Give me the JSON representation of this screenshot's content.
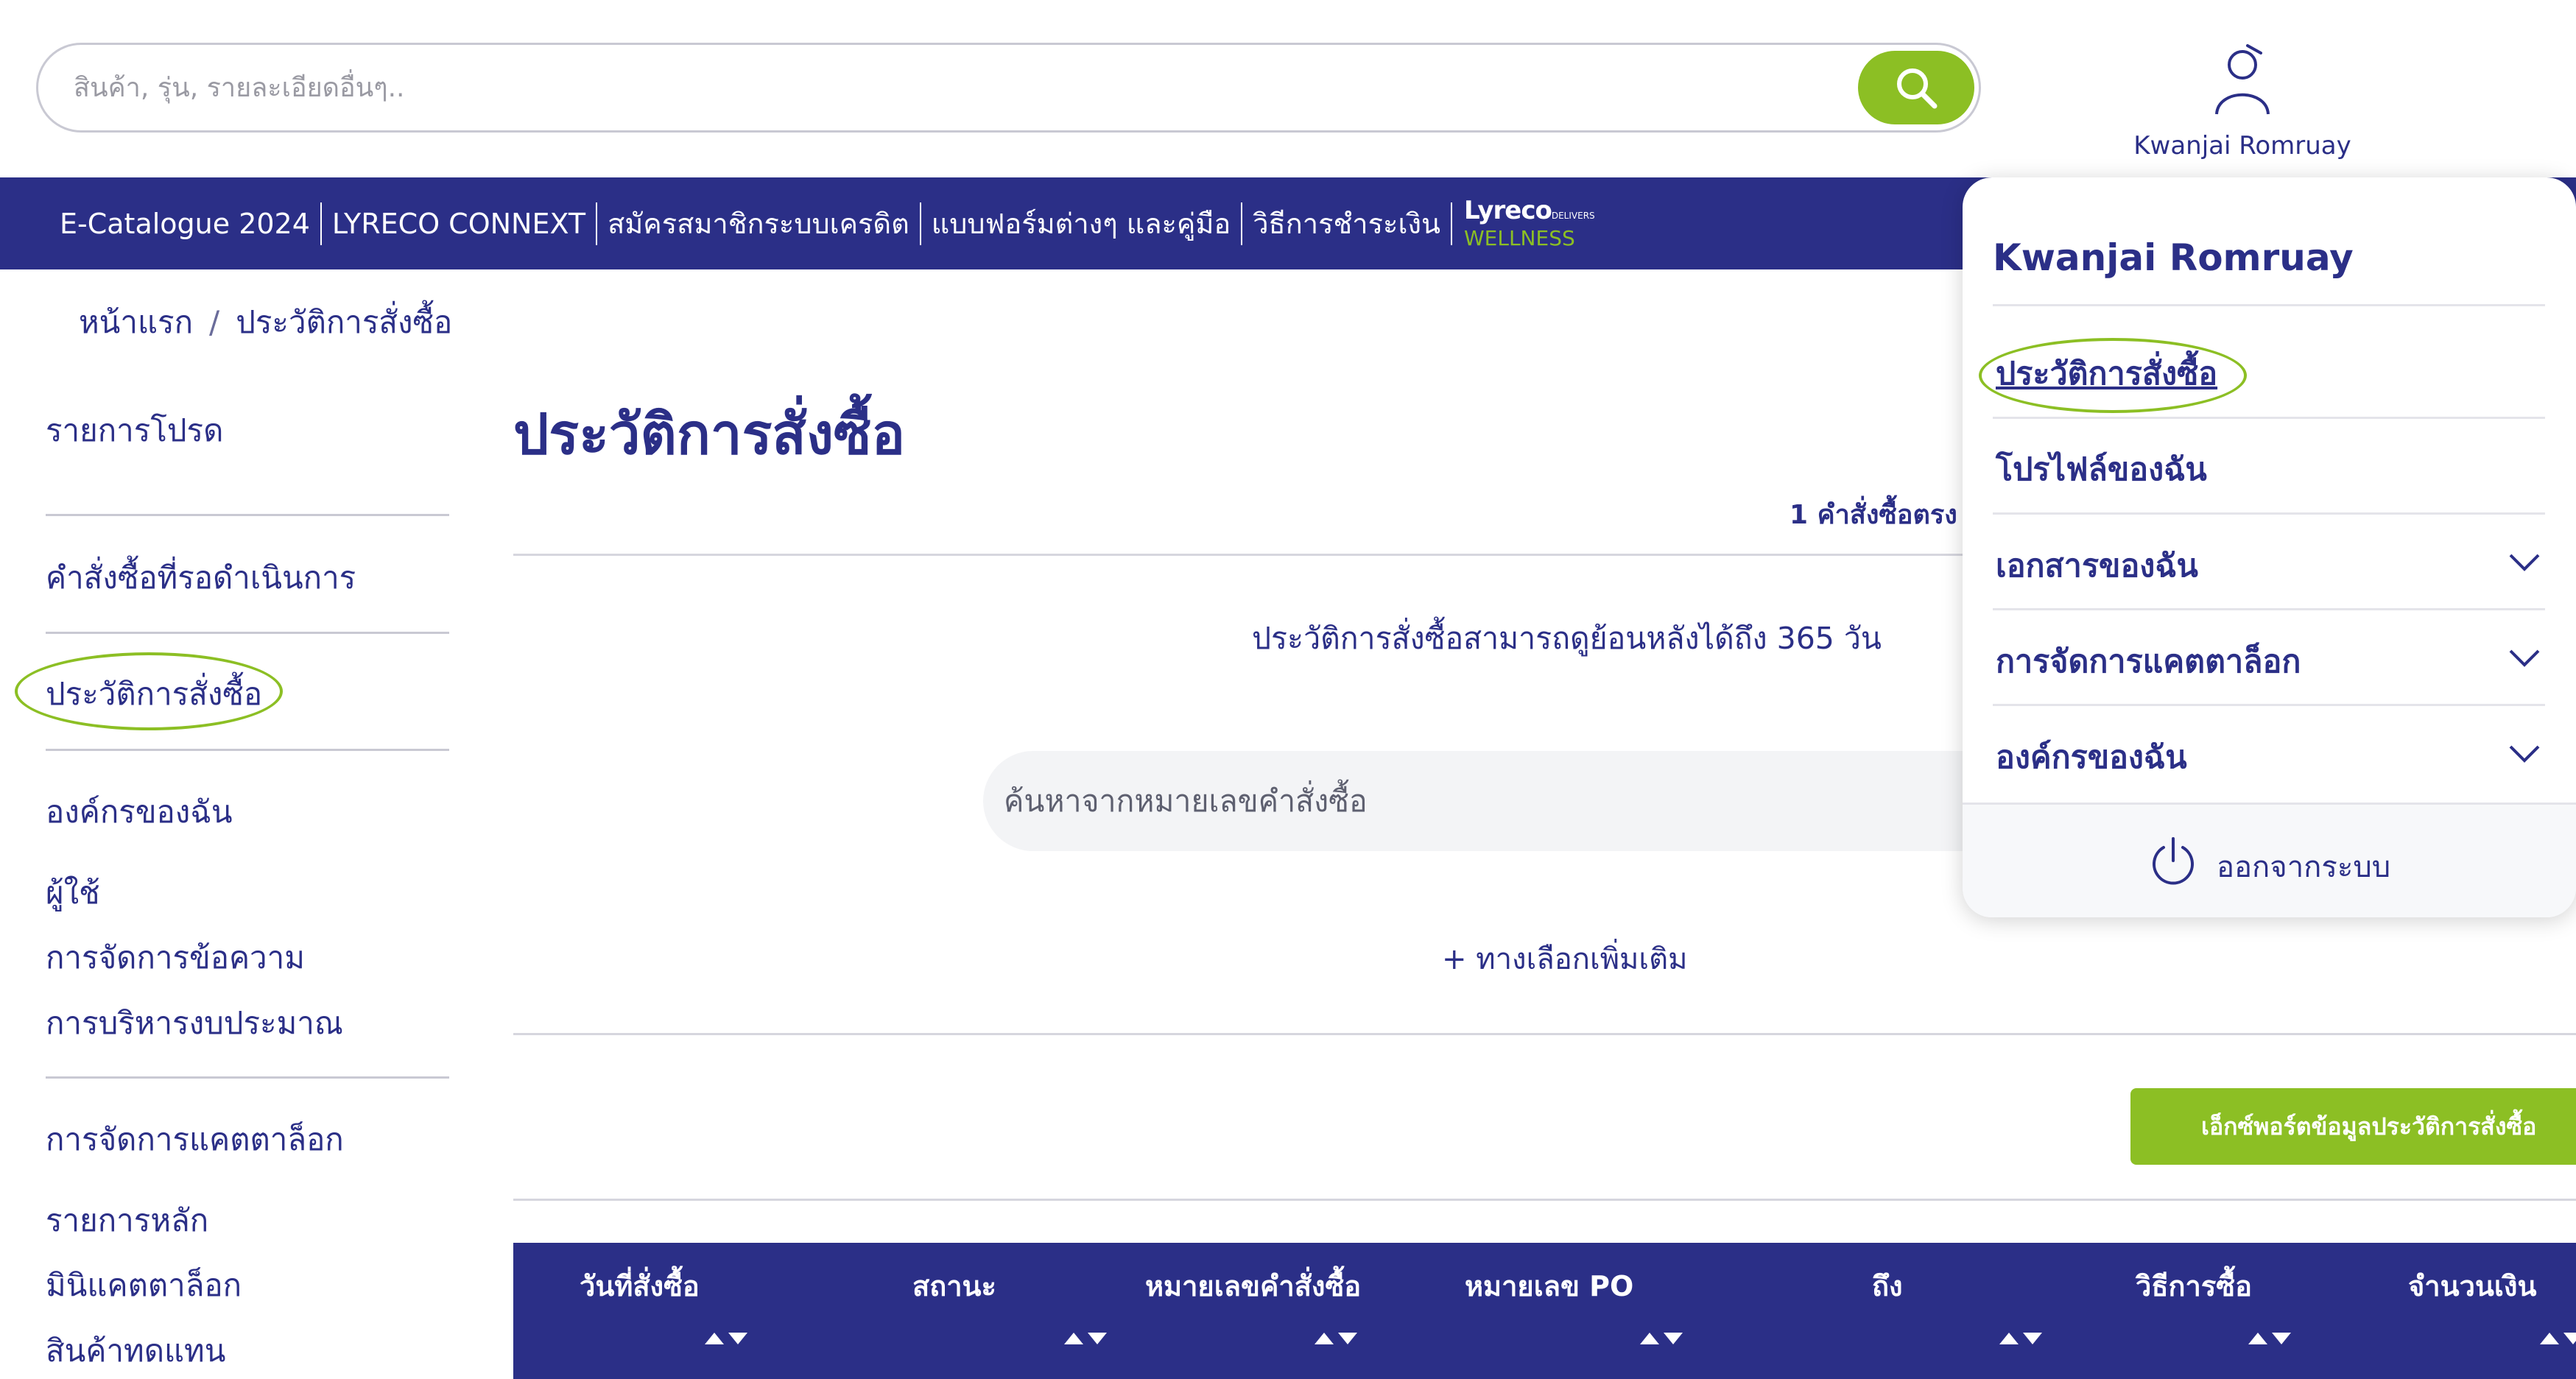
{
  "header": {
    "search_placeholder": "สินค้า, รุ่น, รายละเอียดอื่นๆ..",
    "user_name": "Kwanjai Romruay"
  },
  "nav": {
    "items": [
      "E-Catalogue 2024",
      "LYRECO CONNEXT",
      "สมัครสมาชิกระบบเครดิต",
      "แบบฟอร์มต่างๆ และคู่มือ",
      "วิธีการชำระเงิน"
    ],
    "logo_brand": "Lyreco",
    "logo_small": "DELIVERS",
    "logo_sub": "WELLNESS"
  },
  "breadcrumb": {
    "home": "หน้าแรก",
    "separator": "/",
    "current": "ประวัติการสั่งซื้อ"
  },
  "sidebar": {
    "items": [
      "รายการโปรด",
      "คำสั่งซื้อที่รอดำเนินการ",
      "ประวัติการสั่งซื้อ",
      "องค์กรของฉัน",
      "ผู้ใช้",
      "การจัดการข้อความ",
      "การบริหารงบประมาณ",
      "การจัดการแคตตาล็อก",
      "รายการหลัก",
      "มินิแคตตาล็อก",
      "สินค้าทดแทน"
    ]
  },
  "main": {
    "title": "ประวัติการสั่งซื้อ",
    "count_text": "1 คำสั่งซื้อตรง",
    "info": "ประวัติการสั่งซื้อสามารถดูย้อนหลังได้ถึง 365 วัน",
    "order_search_placeholder": "ค้นหาจากหมายเลขคำสั่งซื้อ",
    "more_options": "+ ทางเลือกเพิ่มเติม",
    "export_label": "เอ็กซ์พอร์ตข้อมูลประวัติการสั่งซื้อ"
  },
  "table": {
    "columns": [
      "วันที่สั่งซื้อ",
      "สถานะ",
      "หมายเลขคำสั่งซื้อ",
      "หมายเลข PO",
      "ถึง",
      "วิธีการซื้อ",
      "จำนวนเงิน"
    ]
  },
  "dropdown": {
    "name": "Kwanjai Romruay",
    "items": [
      "ประวัติการสั่งซื้อ",
      "โปรไฟล์ของฉัน",
      "เอกสารของฉัน",
      "การจัดการแคตตาล็อก",
      "องค์กรของฉัน"
    ],
    "logout": "ออกจากระบบ"
  },
  "colors": {
    "primary": "#2b2f87",
    "accent": "#8cbf24"
  }
}
